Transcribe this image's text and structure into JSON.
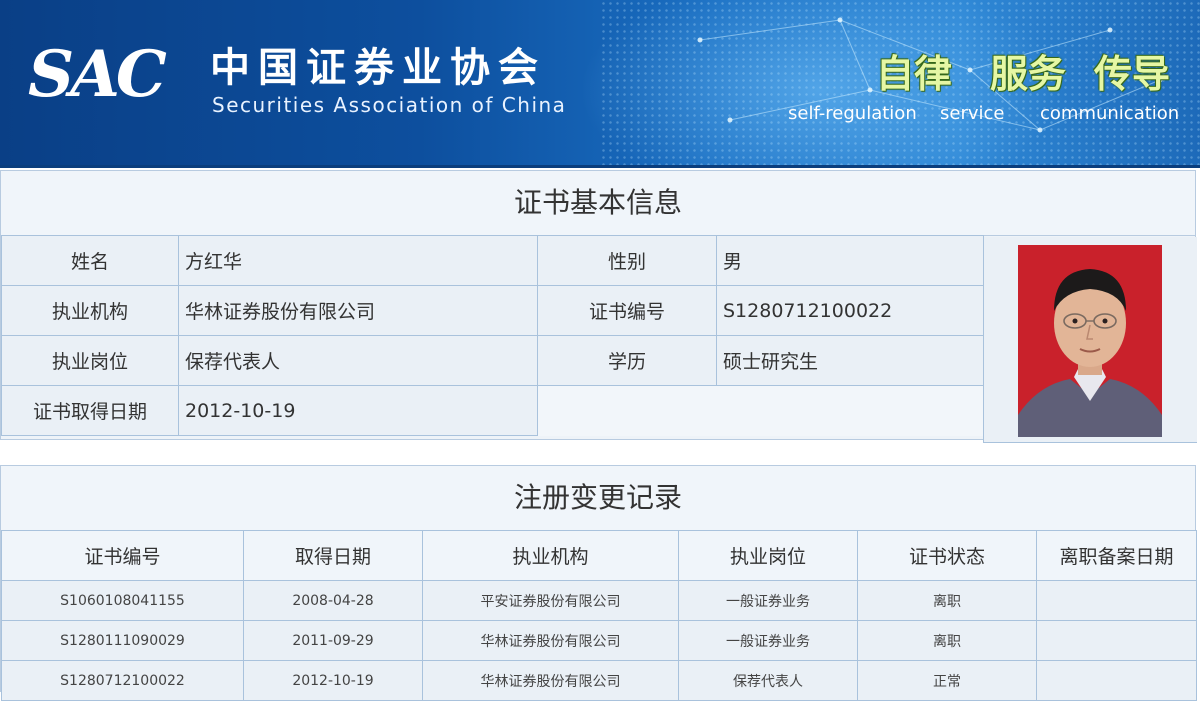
{
  "header": {
    "logo_text": "SAC",
    "org_name_cn": "中国证券业协会",
    "org_name_en": "Securities Association of China",
    "slogans": [
      {
        "cn": "自律",
        "en": "self-regulation"
      },
      {
        "cn": "服务",
        "en": "service"
      },
      {
        "cn": "传导",
        "en": "communication"
      }
    ]
  },
  "basic_info": {
    "title": "证书基本信息",
    "name_label": "姓名",
    "name_value": "方红华",
    "gender_label": "性别",
    "gender_value": "男",
    "org_label": "执业机构",
    "org_value": "华林证券股份有限公司",
    "cert_no_label": "证书编号",
    "cert_no_value": "S1280712100022",
    "position_label": "执业岗位",
    "position_value": "保荐代表人",
    "education_label": "学历",
    "education_value": "硕士研究生",
    "date_label": "证书取得日期",
    "date_value": "2012-10-19"
  },
  "records": {
    "title": "注册变更记录",
    "columns": [
      "证书编号",
      "取得日期",
      "执业机构",
      "执业岗位",
      "证书状态",
      "离职备案日期"
    ],
    "rows": [
      [
        "S1060108041155",
        "2008-04-28",
        "平安证券股份有限公司",
        "一般证券业务",
        "离职",
        ""
      ],
      [
        "S1280111090029",
        "2011-09-29",
        "华林证券股份有限公司",
        "一般证券业务",
        "离职",
        ""
      ],
      [
        "S1280712100022",
        "2012-10-19",
        "华林证券股份有限公司",
        "保荐代表人",
        "正常",
        ""
      ]
    ]
  }
}
